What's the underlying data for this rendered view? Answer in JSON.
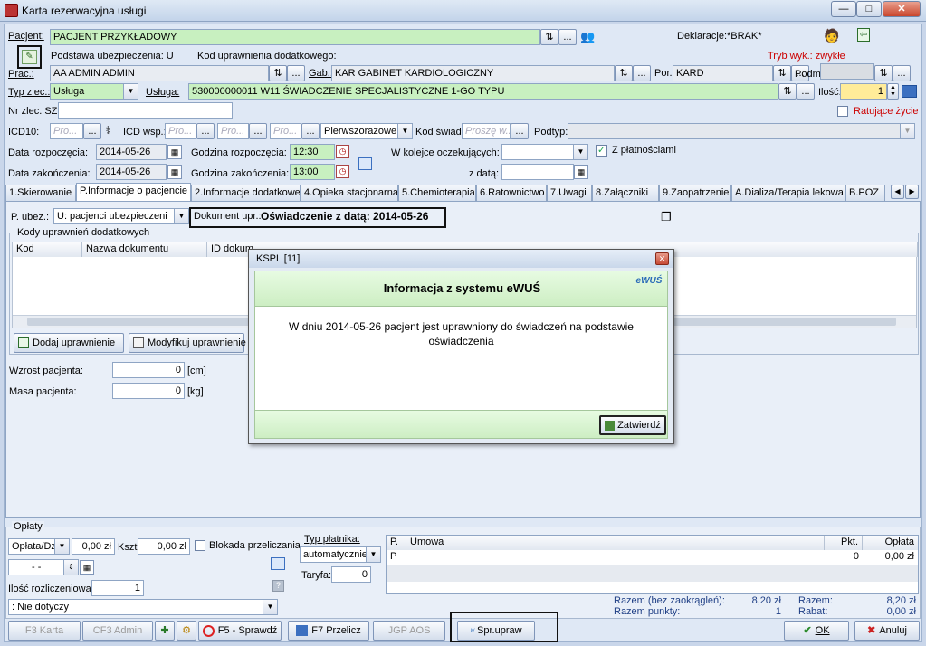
{
  "window": {
    "title": "Karta rezerwacyjna usługi",
    "minimize": "—",
    "maximize": "□",
    "close": "✕"
  },
  "patient": {
    "label": "Pacjent:",
    "value": "PACJENT PRZYKŁADOWY",
    "declaration_label": "Deklaracje:",
    "declaration_value": "*BRAK*",
    "insurance_basis": "Podstawa ubezpieczenia: U",
    "extra_code_label": "Kod uprawnienia dodatkowego:",
    "exec_mode": "Tryb wyk.: zwykłe"
  },
  "row_prac": {
    "prac_label": "Prac.:",
    "prac_value": "AA ADMIN ADMIN",
    "gab_label": "Gab.:",
    "gab_value": "KAR GABINET KARDIOLOGICZNY",
    "por_label": "Por.",
    "por_value": "KARD",
    "podm_label": "Podm."
  },
  "row_type": {
    "type_label": "Typ zlec.:",
    "type_value": "Usługa",
    "service_label": "Usługa:",
    "service_value": "530000000011 W11 ŚWIADCZENIE SPECJALISTYCZNE 1-GO TYPU",
    "qty_label": "Ilość:",
    "qty_value": "1"
  },
  "row_sz": {
    "label": "Nr zlec. SZ:",
    "rescue_label": "Ratujące życie"
  },
  "row_icd": {
    "icd10_label": "ICD10:",
    "icd10_placeholder": "Pro...",
    "icd_wsp_label": "ICD wsp.:",
    "icd_wsp_ph1": "Pro...",
    "icd_wsp_ph2": "Pro...",
    "icd_wsp_ph3": "Pro...",
    "rank_value": "Pierwszorazowe",
    "kod_swiad_label": "Kod świad.",
    "kod_swiad_placeholder": "Proszę w...",
    "podtyp_label": "Podtyp:"
  },
  "dates": {
    "start_label": "Data rozpoczęcia:",
    "start_value": "2014-05-26",
    "start_time_label": "Godzina rozpoczęcia:",
    "start_time_value": "12:30",
    "end_label": "Data zakończenia:",
    "end_value": "2014-05-26",
    "end_time_label": "Godzina zakończenia:",
    "end_time_value": "13:00",
    "queue_label": "W kolejce oczekujących:",
    "with_date_label": "z datą:",
    "paid_label": "Z płatnościami"
  },
  "tabs": [
    {
      "label": "1.Skierowanie"
    },
    {
      "label": "P.Informacje o pacjencie"
    },
    {
      "label": "2.Informacje dodatkowe"
    },
    {
      "label": "4.Opieka stacjonarna"
    },
    {
      "label": "5.Chemioterapia"
    },
    {
      "label": "6.Ratownictwo"
    },
    {
      "label": "7.Uwagi"
    },
    {
      "label": "8.Załączniki"
    },
    {
      "label": "9.Zaopatrzenie"
    },
    {
      "label": "A.Dializa/Terapia lekowa"
    },
    {
      "label": "B.POZ"
    }
  ],
  "panel": {
    "p_ubez_label": "P. ubez.:",
    "p_ubez_value": "U: pacjenci ubezpieczeni",
    "doc_label": "Dokument upr.:",
    "doc_value": "Oświadczenie z datą: 2014-05-26",
    "codes_group": "Kody uprawnień dodatkowych",
    "columns": [
      "Kod",
      "Nazwa dokumentu",
      "ID dokum"
    ],
    "add_button": "Dodaj uprawnienie",
    "modify_button": "Modyfikuj uprawnienie",
    "height_label": "Wzrost pacjenta:",
    "height_value": "0",
    "height_unit": "[cm]",
    "weight_label": "Masa pacjenta:",
    "weight_value": "0",
    "weight_unit": "[kg]"
  },
  "modal": {
    "title": "KSPL [11]",
    "heading": "Informacja z systemu eWUŚ",
    "logo_text": "eWUŚ",
    "message": "W dniu 2014-05-26 pacjent jest uprawniony do świadczeń na podstawie oświadczenia",
    "confirm": "Zatwierdź"
  },
  "payments": {
    "group": "Opłaty",
    "type_value": "Opłata/Dz",
    "amount1": "0,00 zł",
    "kszt_label": "Kszt.:",
    "kszt_value": "0,00 zł",
    "block_label": "Blokada przeliczania",
    "date_value": "-  -",
    "payer_type_label": "Typ płatnika:",
    "payer_type_value": "automatycznie",
    "tariff_label": "Taryfa:",
    "tariff_value": "0",
    "settle_label": "Ilość rozliczeniowa:",
    "settle_value": "1",
    "applies_value": ": Nie dotyczy",
    "table_cols": [
      "P.",
      "Umowa",
      "Pkt.",
      "Opłata"
    ],
    "table_row": {
      "p": "P",
      "umowa": "",
      "pkt": "0",
      "oplata": "0,00 zł"
    },
    "sum_label": "Razem (bez zaokrągleń):",
    "sum_value": "8,20 zł",
    "points_label": "Razem punkty:",
    "points_value": "1",
    "total_label": "Razem:",
    "total_value": "8,20 zł",
    "discount_label": "Rabat:",
    "discount_value": "0,00 zł"
  },
  "bottom": {
    "f3": "F3 Karta",
    "cf3": "CF3 Admin",
    "f5": "F5 - Sprawdź",
    "f7": "F7 Przelicz",
    "jgp": "JGP AOS",
    "spr": "Spr.upraw",
    "ok": "OK",
    "cancel": "Anuluj"
  }
}
